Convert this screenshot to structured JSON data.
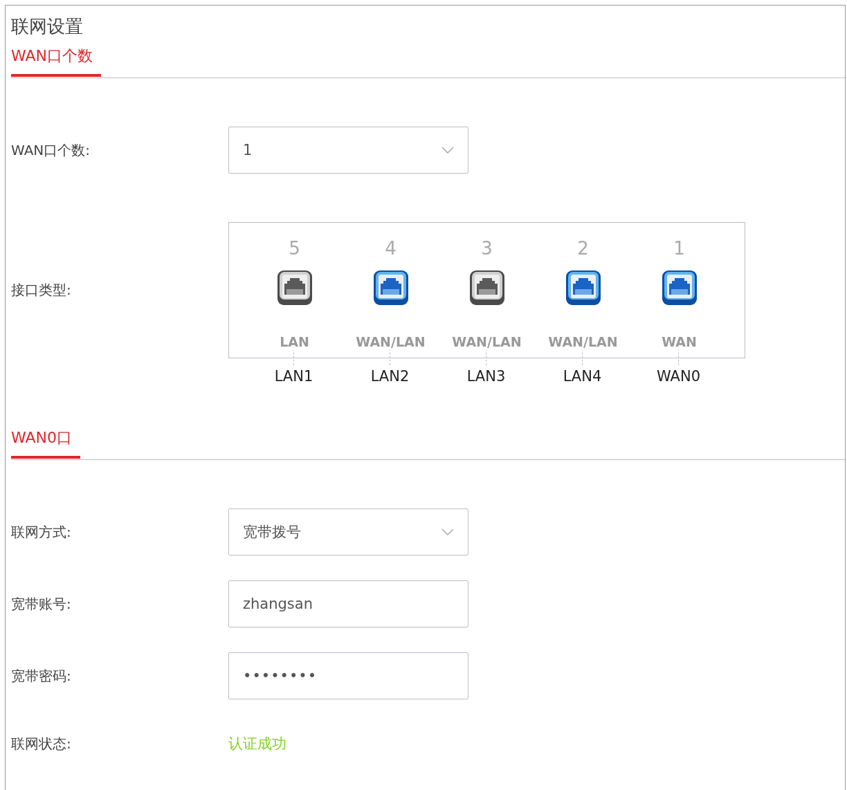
{
  "title": "联网设置",
  "sections": [
    {
      "heading": "WAN口个数"
    },
    {
      "heading": "WAN0口"
    }
  ],
  "wan_count": {
    "label": "WAN口个数:",
    "value": "1"
  },
  "interface_type": {
    "label": "接口类型:",
    "ports": [
      {
        "number": "5",
        "type": "LAN",
        "name": "LAN1",
        "active": false
      },
      {
        "number": "4",
        "type": "WAN/LAN",
        "name": "LAN2",
        "active": true
      },
      {
        "number": "3",
        "type": "WAN/LAN",
        "name": "LAN3",
        "active": false
      },
      {
        "number": "2",
        "type": "WAN/LAN",
        "name": "LAN4",
        "active": true
      },
      {
        "number": "1",
        "type": "WAN",
        "name": "WAN0",
        "active": true
      }
    ]
  },
  "connection_mode": {
    "label": "联网方式:",
    "value": "宽带拨号"
  },
  "account": {
    "label": "宽带账号:",
    "value": "zhangsan"
  },
  "password": {
    "label": "宽带密码:",
    "value": "••••••••"
  },
  "status": {
    "label": "联网状态:",
    "value": "认证成功"
  }
}
